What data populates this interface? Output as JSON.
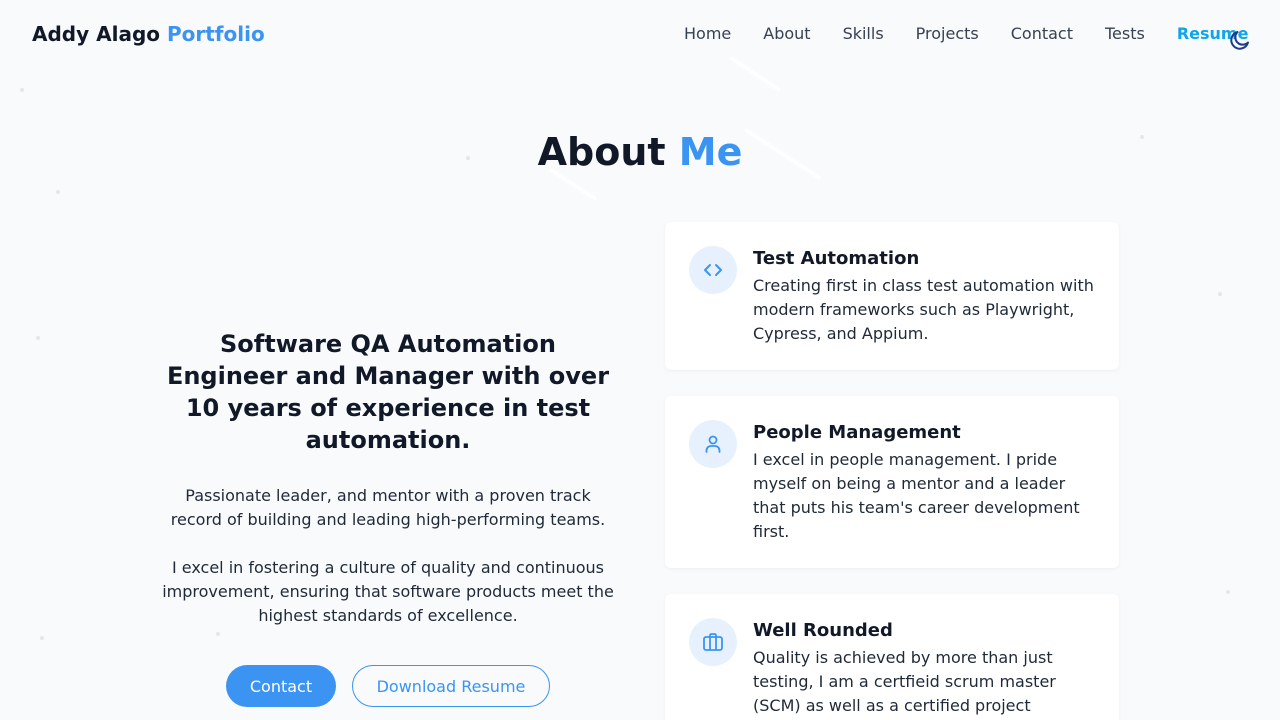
{
  "header": {
    "brand_name": "Addy Alago",
    "brand_accent": "Portfolio",
    "nav": [
      "Home",
      "About",
      "Skills",
      "Projects",
      "Contact",
      "Tests"
    ],
    "resume_link": "Resume",
    "theme_toggle_icon": "moon-icon"
  },
  "section": {
    "title_main": "About",
    "title_accent": "Me"
  },
  "intro": {
    "headline": "Software QA Automation Engineer and Manager with over 10 years of experience in test automation.",
    "paragraph1": "Passionate leader, and mentor with a proven track record of building and leading high-performing teams.",
    "paragraph2": "I excel in fostering a culture of quality and continuous improvement, ensuring that software products meet the highest standards of excellence.",
    "contact_button": "Contact",
    "download_button": "Download Resume"
  },
  "cards": [
    {
      "icon": "code-icon",
      "title": "Test Automation",
      "text": "Creating first in class test automation with modern frameworks such as Playwright, Cypress, and Appium."
    },
    {
      "icon": "user-icon",
      "title": "People Management",
      "text": "I excel in people management. I pride myself on being a mentor and a leader that puts his team's career development first."
    },
    {
      "icon": "briefcase-icon",
      "title": "Well Rounded",
      "text": "Quality is achieved by more than just testing, I am a certfieid scrum master (SCM) as well as a certified project"
    }
  ],
  "colors": {
    "accent": "#3b94f2",
    "resume": "#0ea5e9",
    "background": "#f8fafc",
    "icon_bg": "#e6f1fd"
  }
}
